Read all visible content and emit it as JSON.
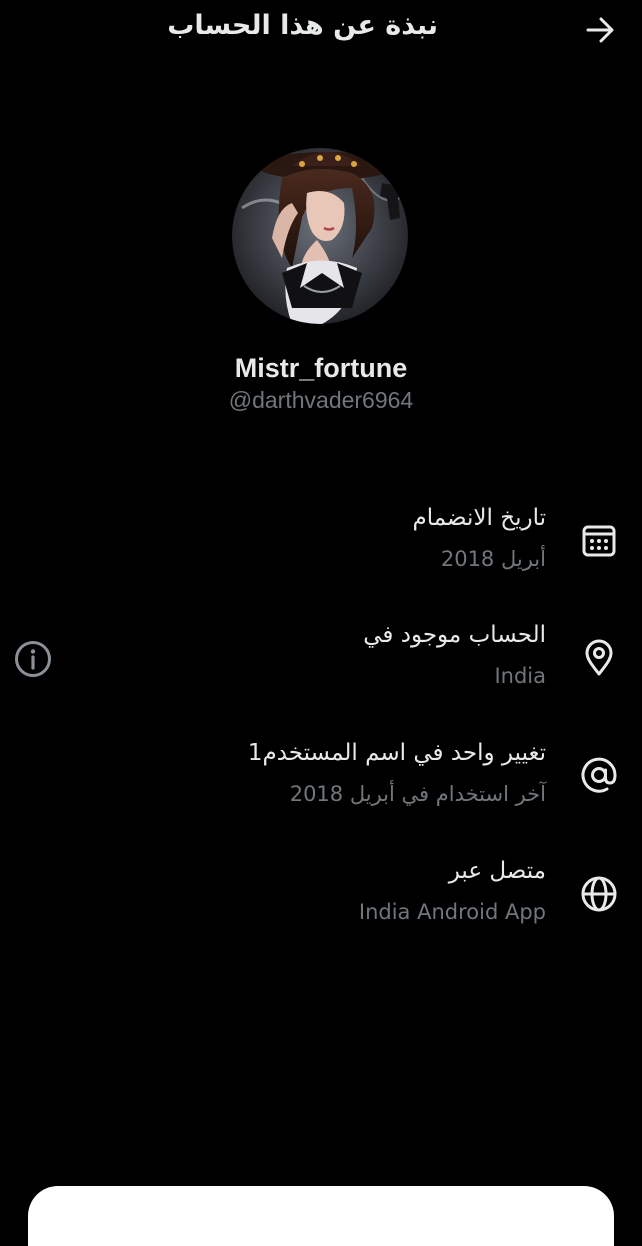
{
  "header": {
    "title": "نبذة عن هذا الحساب",
    "back_icon": "arrow-right-icon"
  },
  "profile": {
    "display_name": "Mistr_fortune",
    "handle": "@darthvader6964"
  },
  "rows": [
    {
      "icon": "calendar-icon",
      "label": "تاريخ الانضمام",
      "value": "أبريل 2018"
    },
    {
      "icon": "location-pin-icon",
      "label": "الحساب موجود في",
      "value": "India"
    },
    {
      "icon": "at-sign-icon",
      "label": "تغيير واحد في اسم المستخدم1",
      "value": "آخر استخدام في أبريل 2018"
    },
    {
      "icon": "globe-icon",
      "label": "متصل عبر",
      "value": "India Android App"
    }
  ],
  "colors": {
    "background": "#000000",
    "primary_text": "#e7e9ea",
    "secondary_text": "#71767b"
  }
}
